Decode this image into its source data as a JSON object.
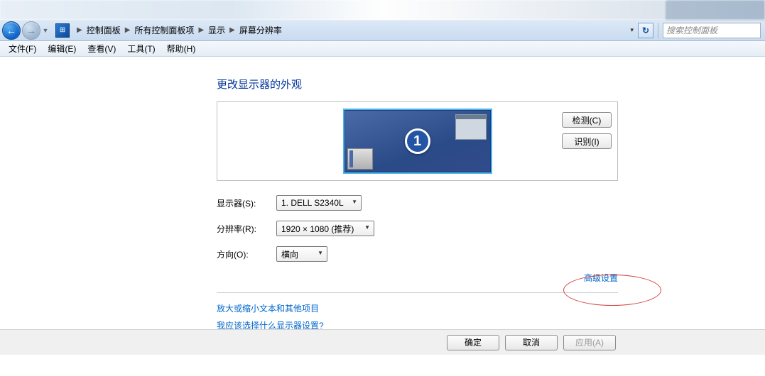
{
  "breadcrumb": {
    "parts": [
      "控制面板",
      "所有控制面板项",
      "显示",
      "屏幕分辨率"
    ]
  },
  "search": {
    "placeholder": "搜索控制面板"
  },
  "menu": {
    "file": "文件(F)",
    "edit": "编辑(E)",
    "view": "查看(V)",
    "tools": "工具(T)",
    "help": "帮助(H)"
  },
  "page": {
    "title": "更改显示器的外观",
    "detect": "检测(C)",
    "identify": "识别(I)",
    "monitor_label": "显示器(S):",
    "monitor_value": "1. DELL S2340L",
    "resolution_label": "分辨率(R):",
    "resolution_value": "1920 × 1080 (推荐)",
    "orientation_label": "方向(O):",
    "orientation_value": "横向",
    "advanced": "高级设置",
    "help1": "放大或缩小文本和其他项目",
    "help2": "我应该选择什么显示器设置?",
    "monitor_badge": "1"
  },
  "buttons": {
    "ok": "确定",
    "cancel": "取消",
    "apply": "应用(A)"
  }
}
